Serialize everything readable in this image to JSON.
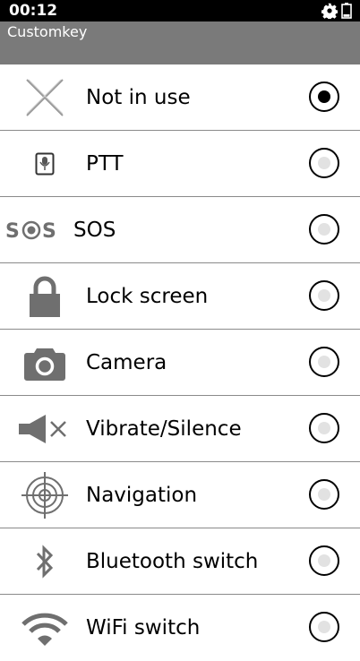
{
  "status_bar": {
    "time": "00:12",
    "icons": [
      "gear-icon",
      "battery-icon"
    ]
  },
  "header": {
    "title": "Customkey"
  },
  "options": [
    {
      "label": "Not in use",
      "icon": "not-in-use-x-icon",
      "selected": true
    },
    {
      "label": "PTT",
      "icon": "ptt-microphone-icon",
      "selected": false
    },
    {
      "label": "SOS",
      "icon": "sos-icon",
      "icon_text": "S⊙S",
      "selected": false
    },
    {
      "label": "Lock screen",
      "icon": "lock-icon",
      "selected": false
    },
    {
      "label": "Camera",
      "icon": "camera-icon",
      "selected": false
    },
    {
      "label": "Vibrate/Silence",
      "icon": "speaker-mute-icon",
      "selected": false
    },
    {
      "label": "Navigation",
      "icon": "navigation-crosshair-icon",
      "selected": false
    },
    {
      "label": "Bluetooth switch",
      "icon": "bluetooth-icon",
      "selected": false
    },
    {
      "label": "WiFi switch",
      "icon": "wifi-icon",
      "selected": false
    }
  ],
  "colors": {
    "title_bar": "#7a7a7a",
    "status_bar": "#000000",
    "icon_gray": "#6f6f6f",
    "divider": "#8a8a8a"
  }
}
